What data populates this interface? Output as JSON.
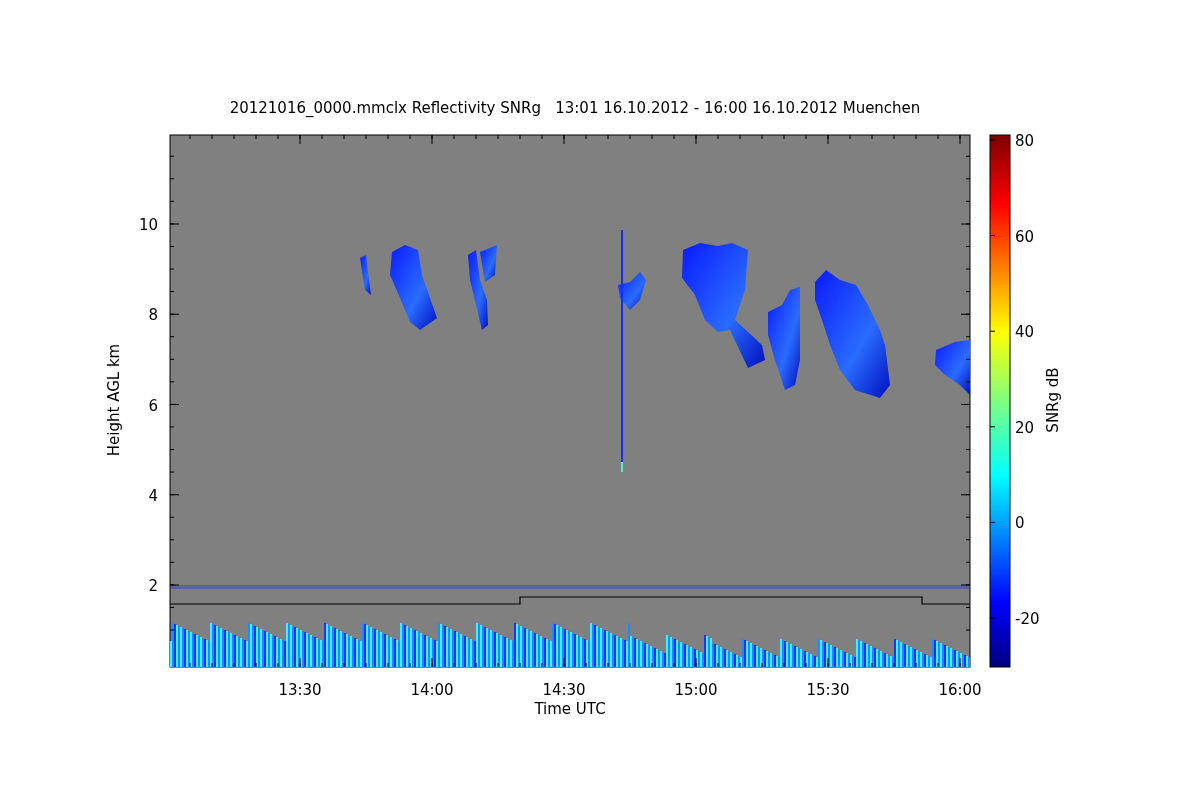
{
  "title": "20121016_0000.mmclx Reflectivity SNRg   13:01 16.10.2012 - 16:00 16.10.2012 Muenchen",
  "plot": {
    "xlabel": "Time UTC",
    "ylabel": "Height AGL km",
    "xticks": [
      "13:30",
      "14:00",
      "14:30",
      "15:00",
      "15:30",
      "16:00"
    ],
    "yticks": [
      "10",
      "8",
      "6",
      "4",
      "2"
    ]
  },
  "colorbar": {
    "label": "SNRg dB",
    "ticks": [
      "80",
      "60",
      "40",
      "20",
      "0",
      "-20"
    ]
  }
}
